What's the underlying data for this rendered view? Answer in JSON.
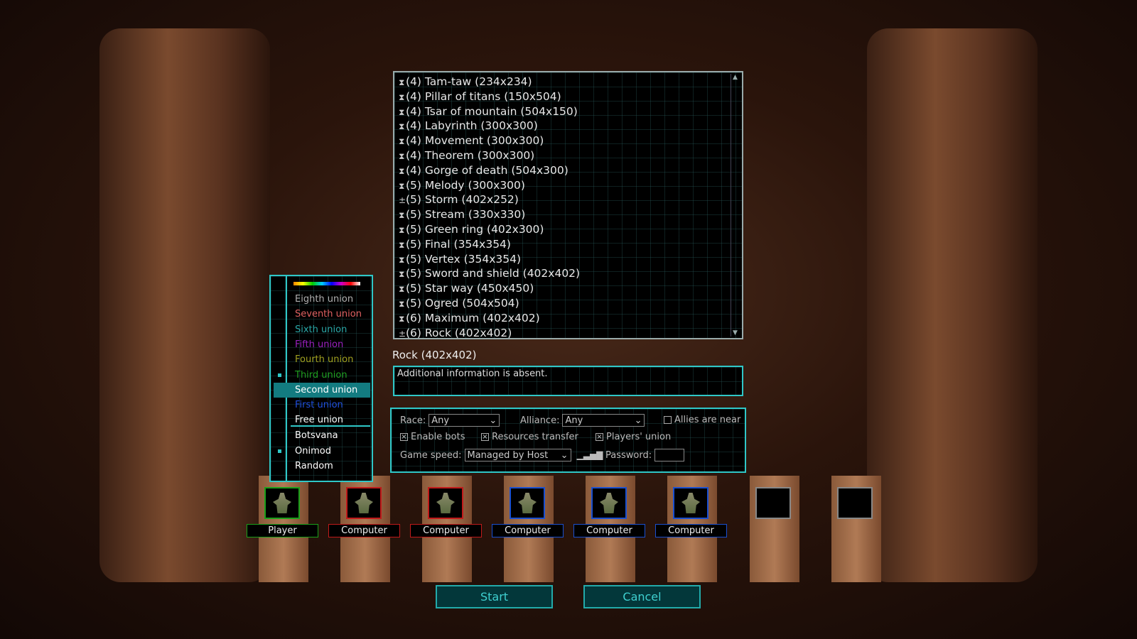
{
  "maps": [
    {
      "icon": "hourglass",
      "label": "(4) Tam-taw (234x234)"
    },
    {
      "icon": "hourglass",
      "label": "(4) Pillar of titans (150x504)"
    },
    {
      "icon": "hourglass",
      "label": "(4) Tsar of mountain (504x150)"
    },
    {
      "icon": "hourglass",
      "label": "(4) Labyrinth (300x300)"
    },
    {
      "icon": "hourglass",
      "label": "(4) Movement (300x300)"
    },
    {
      "icon": "hourglass",
      "label": "(4) Theorem (300x300)"
    },
    {
      "icon": "hourglass",
      "label": "(4) Gorge of death (504x300)"
    },
    {
      "icon": "hourglass",
      "label": "(5) Melody (300x300)"
    },
    {
      "icon": "pin",
      "label": "(5) Storm (402x252)"
    },
    {
      "icon": "hourglass",
      "label": "(5) Stream (330x330)"
    },
    {
      "icon": "hourglass",
      "label": "(5) Green ring (402x300)"
    },
    {
      "icon": "hourglass",
      "label": "(5) Final (354x354)"
    },
    {
      "icon": "hourglass",
      "label": "(5) Vertex (354x354)"
    },
    {
      "icon": "hourglass",
      "label": "(5) Sword and shield (402x402)"
    },
    {
      "icon": "hourglass",
      "label": "(5) Star way (450x450)"
    },
    {
      "icon": "hourglass",
      "label": "(5) Ogred (504x504)"
    },
    {
      "icon": "hourglass",
      "label": "(6) Maximum (402x402)"
    },
    {
      "icon": "pin",
      "label": "(6) Rock (402x402)"
    }
  ],
  "selected_map": "Rock (402x402)",
  "info": "Additional information is absent.",
  "settings": {
    "race_label": "Race:",
    "race_value": "Any",
    "alliance_label": "Alliance:",
    "alliance_value": "Any",
    "allies_near": "Allies are near",
    "allies_near_checked": false,
    "enable_bots": "Enable bots",
    "enable_bots_checked": true,
    "resources_transfer": "Resources transfer",
    "resources_transfer_checked": true,
    "players_union": "Players' union",
    "players_union_checked": true,
    "speed_label": "Game speed:",
    "speed_value": "Managed by Host",
    "password_label": "Password:",
    "password_value": ""
  },
  "unions": [
    {
      "label": "Eighth union",
      "color": "#b0b0b0"
    },
    {
      "label": "Seventh union",
      "color": "#e06060"
    },
    {
      "label": "Sixth union",
      "color": "#2aa8a8"
    },
    {
      "label": "Fifth union",
      "color": "#9a20c0"
    },
    {
      "label": "Fourth union",
      "color": "#a0a020"
    },
    {
      "label": "Third union",
      "color": "#20a020",
      "marked": true
    },
    {
      "label": "Second union",
      "color": "#ffffff",
      "selected": true
    },
    {
      "label": "First union",
      "color": "#2050e0"
    },
    {
      "label": "Free union",
      "color": "#ffffff"
    }
  ],
  "races": [
    {
      "label": "Botsvana"
    },
    {
      "label": "Onimod",
      "marked": true
    },
    {
      "label": "Random"
    }
  ],
  "slots": [
    {
      "label": "Player",
      "color": "#1aa01a"
    },
    {
      "label": "Computer",
      "color": "#c01a1a"
    },
    {
      "label": "Computer",
      "color": "#c01a1a"
    },
    {
      "label": "Computer",
      "color": "#1a50d0"
    },
    {
      "label": "Computer",
      "color": "#1a50d0"
    },
    {
      "label": "Computer",
      "color": "#1a50d0"
    },
    {
      "label": "",
      "color": "#888888"
    },
    {
      "label": "",
      "color": "#888888"
    }
  ],
  "buttons": {
    "start": "Start",
    "cancel": "Cancel"
  }
}
